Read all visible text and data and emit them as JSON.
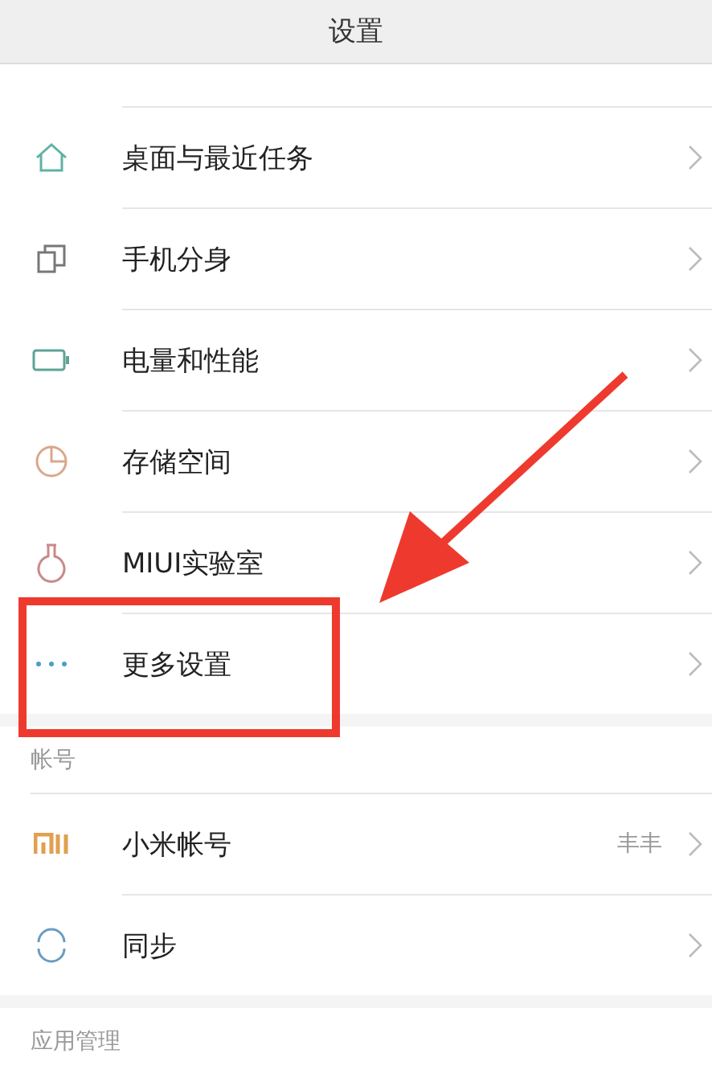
{
  "header": {
    "title": "设置"
  },
  "sections": [
    {
      "items": [
        {
          "kind": "home",
          "label": "桌面与最近任务"
        },
        {
          "kind": "clone",
          "label": "手机分身"
        },
        {
          "kind": "battery",
          "label": "电量和性能"
        },
        {
          "kind": "pie",
          "label": "存储空间"
        },
        {
          "kind": "flask",
          "label": "MIUI实验室"
        },
        {
          "kind": "dots",
          "label": "更多设置"
        }
      ]
    },
    {
      "heading": "帐号",
      "items": [
        {
          "kind": "mi",
          "label": "小米帐号",
          "value": "丰丰"
        },
        {
          "kind": "sync",
          "label": "同步"
        }
      ]
    },
    {
      "heading": "应用管理"
    }
  ]
}
